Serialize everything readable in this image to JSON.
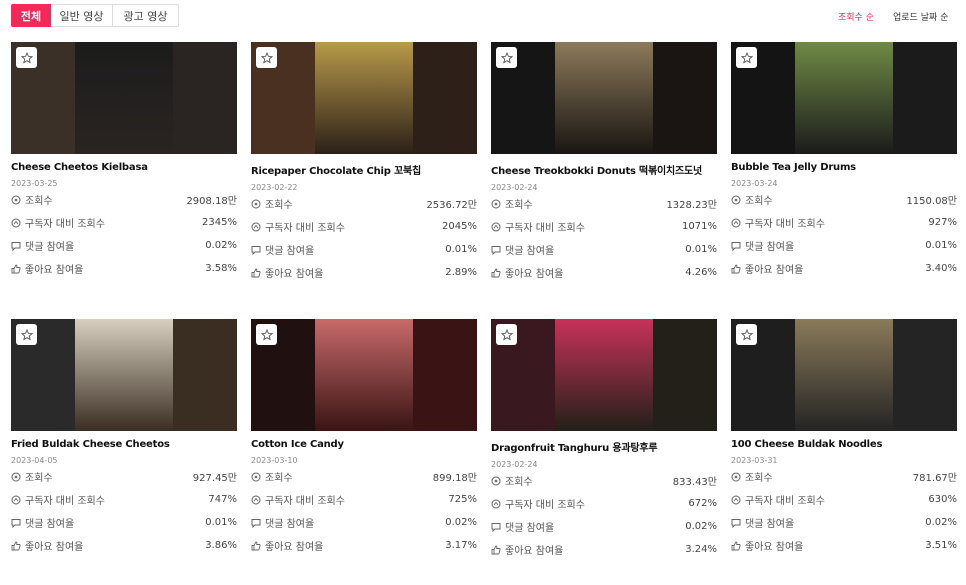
{
  "tabs": [
    "전체",
    "일반 영상",
    "광고 영상"
  ],
  "sort_options": [
    "조회수 순",
    "업로드 날짜 순"
  ],
  "stat_labels": {
    "views": "조회수",
    "views_vs_subs": "구독자 대비 조회수",
    "comment_rate": "댓글 참여율",
    "like_rate": "좋아요 참여율"
  },
  "videos": [
    {
      "title": "Cheese Cheetos Kielbasa",
      "date": "2023-03-25",
      "views": "2908.18만",
      "views_vs_subs": "2345%",
      "comment_rate": "0.02%",
      "like_rate": "3.58%",
      "colors": [
        "#3a3028",
        "#1c1c1c",
        "#2a2422"
      ]
    },
    {
      "title": "Ricepaper Chocolate Chip 꼬북칩",
      "date": "2023-02-22",
      "views": "2536.72만",
      "views_vs_subs": "2045%",
      "comment_rate": "0.01%",
      "like_rate": "2.89%",
      "colors": [
        "#4a3020",
        "#b89a4a",
        "#2c2018"
      ]
    },
    {
      "title": "Cheese Treokbokki Donuts 떡볶이치즈도넛",
      "date": "2023-02-24",
      "views": "1328.23만",
      "views_vs_subs": "1071%",
      "comment_rate": "0.01%",
      "like_rate": "4.26%",
      "colors": [
        "#151515",
        "#8c7a5a",
        "#1a1512"
      ]
    },
    {
      "title": "Bubble Tea Jelly Drums",
      "date": "2023-03-24",
      "views": "1150.08만",
      "views_vs_subs": "927%",
      "comment_rate": "0.01%",
      "like_rate": "3.40%",
      "colors": [
        "#141414",
        "#6f8a45",
        "#1b1b1b"
      ]
    },
    {
      "title": "Fried Buldak Cheese Cheetos",
      "date": "2023-04-05",
      "views": "927.45만",
      "views_vs_subs": "747%",
      "comment_rate": "0.01%",
      "like_rate": "3.86%",
      "colors": [
        "#2a2a2a",
        "#d8cfc0",
        "#3a2e22"
      ]
    },
    {
      "title": "Cotton Ice Candy",
      "date": "2023-03-10",
      "views": "899.18만",
      "views_vs_subs": "725%",
      "comment_rate": "0.02%",
      "like_rate": "3.17%",
      "colors": [
        "#201010",
        "#c86a6a",
        "#3a1414"
      ]
    },
    {
      "title": "Dragonfruit Tanghuru 용과탕후루",
      "date": "2023-02-24",
      "views": "833.43만",
      "views_vs_subs": "672%",
      "comment_rate": "0.02%",
      "like_rate": "3.24%",
      "colors": [
        "#3a1820",
        "#c8325a",
        "#222018"
      ]
    },
    {
      "title": "100 Cheese Buldak Noodles",
      "date": "2023-03-31",
      "views": "781.67만",
      "views_vs_subs": "630%",
      "comment_rate": "0.02%",
      "like_rate": "3.51%",
      "colors": [
        "#1e1e1e",
        "#8a7a5a",
        "#242424"
      ]
    }
  ]
}
